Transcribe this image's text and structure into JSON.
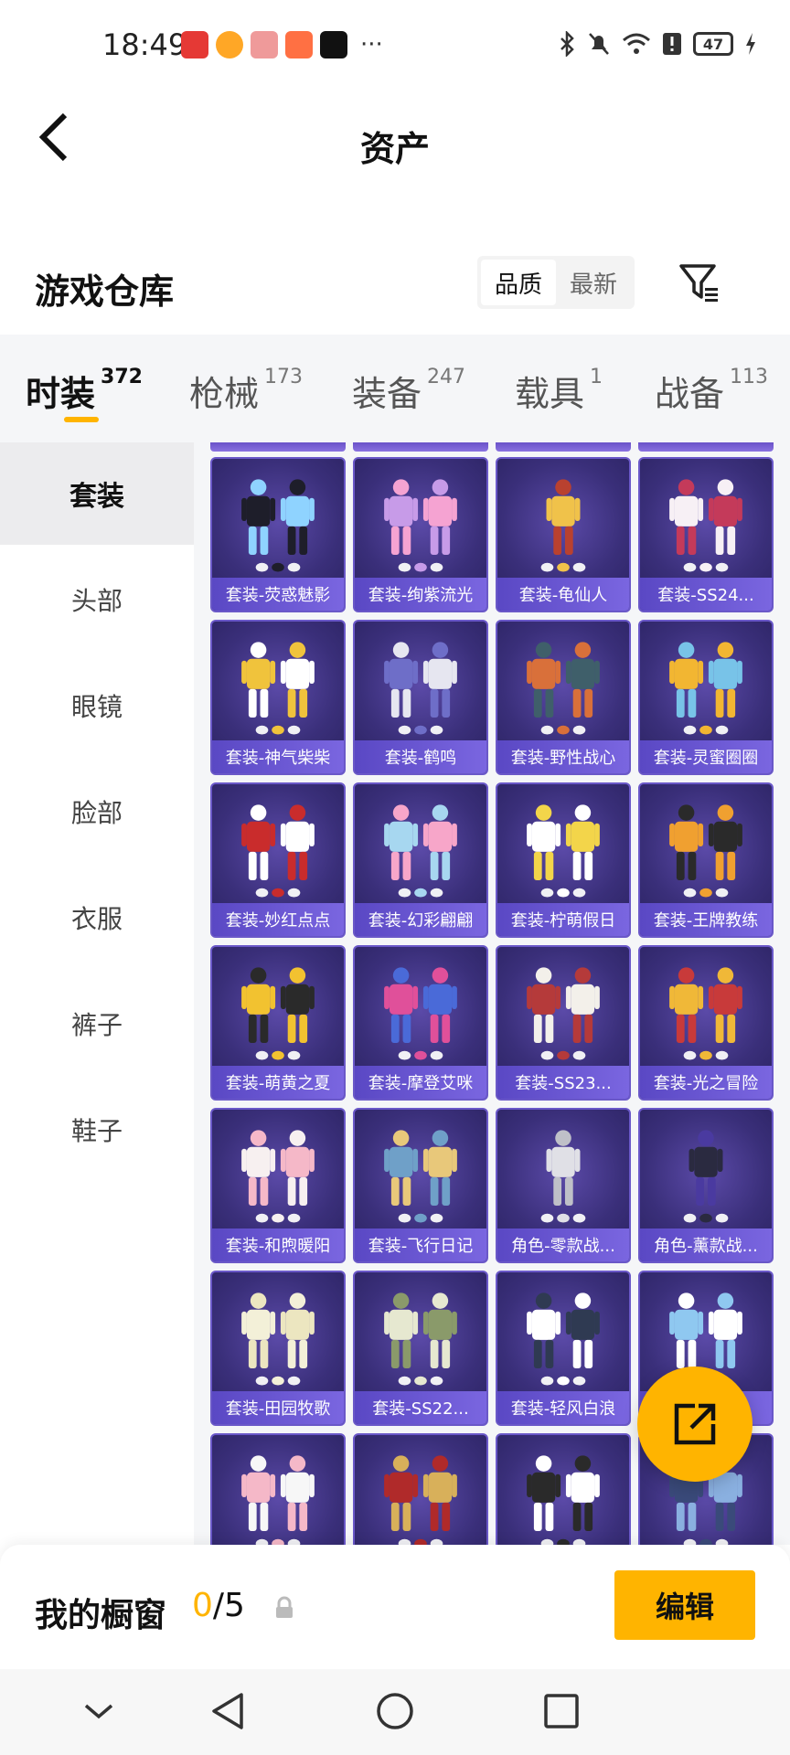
{
  "status_bar": {
    "time": "18:49",
    "more": "···",
    "battery": "47"
  },
  "header": {
    "title": "资产"
  },
  "section": {
    "title": "游戏仓库",
    "sort_options": [
      "品质",
      "最新"
    ],
    "sort_selected": "品质"
  },
  "tabs": [
    {
      "label": "时装",
      "count": "372",
      "active": true
    },
    {
      "label": "枪械",
      "count": "173"
    },
    {
      "label": "装备",
      "count": "247"
    },
    {
      "label": "载具",
      "count": "1"
    },
    {
      "label": "战备",
      "count": "113"
    }
  ],
  "sidebar": {
    "items": [
      {
        "label": "套装",
        "active": true
      },
      {
        "label": "头部"
      },
      {
        "label": "眼镜"
      },
      {
        "label": "脸部"
      },
      {
        "label": "衣服"
      },
      {
        "label": "裤子"
      },
      {
        "label": "鞋子"
      }
    ]
  },
  "grid": {
    "items": [
      {
        "label": "套装-荧惑魅影"
      },
      {
        "label": "套装-绚紫流光"
      },
      {
        "label": "套装-龟仙人"
      },
      {
        "label": "套装-SS24..."
      },
      {
        "label": "套装-神气柴柴"
      },
      {
        "label": "套装-鹤鸣"
      },
      {
        "label": "套装-野性战心"
      },
      {
        "label": "套装-灵蜜圈圈"
      },
      {
        "label": "套装-妙红点点"
      },
      {
        "label": "套装-幻彩翩翩"
      },
      {
        "label": "套装-柠萌假日"
      },
      {
        "label": "套装-王牌教练"
      },
      {
        "label": "套装-萌黄之夏"
      },
      {
        "label": "套装-摩登艾咪"
      },
      {
        "label": "套装-SS23..."
      },
      {
        "label": "套装-光之冒险"
      },
      {
        "label": "套装-和煦暖阳"
      },
      {
        "label": "套装-飞行日记"
      },
      {
        "label": "角色-零款战..."
      },
      {
        "label": "角色-薰款战..."
      },
      {
        "label": "套装-田园牧歌"
      },
      {
        "label": "套装-SS22..."
      },
      {
        "label": "套装-轻风白浪"
      },
      {
        "label": "祥"
      },
      {
        "label": ""
      },
      {
        "label": ""
      },
      {
        "label": ""
      },
      {
        "label": ""
      }
    ]
  },
  "showcase": {
    "label": "我的橱窗",
    "current": "0",
    "separator": "/",
    "max": "5",
    "edit_label": "编辑"
  },
  "colors": {
    "accent": "#ffb400",
    "card_bg": "#3a2f7a",
    "card_label_bg": "#6a58c8"
  }
}
